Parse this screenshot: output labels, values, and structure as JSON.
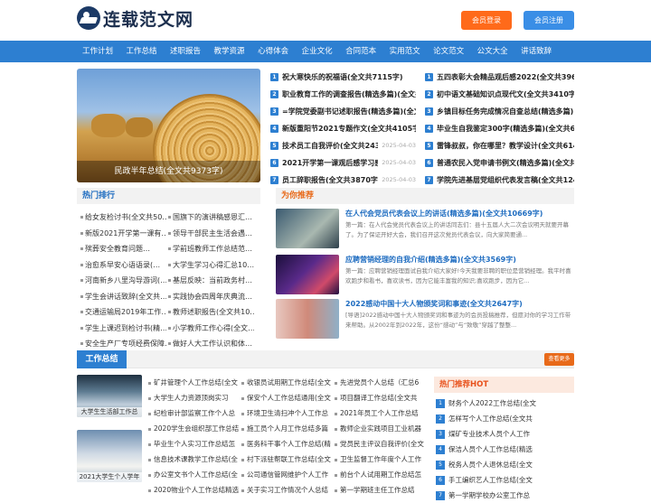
{
  "site": {
    "logo_text": "连载范文网",
    "login_label": "会员登录",
    "register_label": "会员注册"
  },
  "nav": [
    "工作计划",
    "工作总结",
    "述职报告",
    "教学资源",
    "心得体会",
    "企业文化",
    "合同范本",
    "实用范文",
    "论文范文",
    "公文大全",
    "讲话致辞"
  ],
  "banner": {
    "caption": "民政半年总结(全文共9373字)"
  },
  "top_left": [
    {
      "n": "1",
      "t": "祝大寒快乐的祝福语(全文共7115字)",
      "d": ""
    },
    {
      "n": "2",
      "t": "职业教育工作的调查报告(精选多篇)(全文共",
      "d": ""
    },
    {
      "n": "3",
      "t": "=学院党委副书记述职报告(精选多篇)(全文共",
      "d": ""
    },
    {
      "n": "4",
      "t": "新版重阳节2021专题作文(全文共4105字)",
      "d": ""
    },
    {
      "n": "5",
      "t": "技术员工自我评价(全文共2438字)",
      "d": "2025-04-03"
    },
    {
      "n": "6",
      "t": "2021开学第一课观后感学习感悟多篇(全文共",
      "d": "2025-04-03"
    },
    {
      "n": "7",
      "t": "员工辞职报告(全文共3870字)",
      "d": "2025-04-03"
    }
  ],
  "top_right": [
    {
      "n": "1",
      "t": "五四表彰大会精品观后感2022(全文共3960"
    },
    {
      "n": "2",
      "t": "初中语文基础知识点现代文(全文共3410字)"
    },
    {
      "n": "3",
      "t": "乡镇目标任务完成情况自查总结(精选多篇)"
    },
    {
      "n": "4",
      "t": "毕业生自我鉴定300字(精选多篇)(全文共6571"
    },
    {
      "n": "5",
      "t": "雷锋叔叔，你在哪里？教学设计(全文共614"
    },
    {
      "n": "6",
      "t": "普通农民入党申请书例文(精选多篇)(全文共"
    },
    {
      "n": "7",
      "t": "学院先进基层党组织代表发言稿(全文共1240"
    }
  ],
  "hot_rank": {
    "title": "热门排行",
    "left": [
      "给女友检讨书(全文共50…",
      "新版2021开学第一课有…",
      "殡葬安全教育问题…",
      "治愈系早安心语语录(…",
      "河南新乡八里沟导游词(…",
      "学生会讲话致辞(全文共…",
      "交通运输局2019年工作…",
      "学生上课迟到检讨书(精…",
      "安全生产厂专项经费保障…"
    ],
    "right": [
      "国旗下的演讲稿感恩汇…",
      "领导干部民主生活会遇…",
      "学前班教师工作总结范…",
      "大学生学习心得汇总10…",
      "基层反映：当前政务村…",
      "实践协会四周年庆典流…",
      "教师述职报告(全文共10…",
      "小学教师工作心得(全文…",
      "做好人大工作认识和体…"
    ]
  },
  "recommend": {
    "title": "为你推荐",
    "items": [
      {
        "title": "在人代会党员代表会议上的讲话(精选多篇)(全文共10669字)",
        "desc": "第一篇：在人代会党员代表会议上的讲话同志们：县十五届人大二次会议明天就要开幕了。为了保证开好大会，我们召开这次党员代表会议，向大家简要通..."
      },
      {
        "title": "应聘营销经理的自我介绍(精选多篇)(全文共3569字)",
        "desc": "第一篇：应聘营销经理面试自我介绍大家好!今天我要非聘的职位是营销经理。我平时喜欢跑步和看书，喜欢读书，因为它能丰富我的知识;喜欢跑步，因为它..."
      },
      {
        "title": "2022感动中国十大人物颁奖词和事迹(全文共2647字)",
        "desc": "[导语]2022感动中国十大人物颁奖词和事迹为的会员投稿推荐，但愿对你的学习工作带来帮助。从2002年到2022年，这份“感动”与“致敬”穿越了整整..."
      }
    ]
  },
  "work_summary": {
    "title": "工作总结",
    "more_label": "查看更多",
    "thumbs": [
      "大学生生活部工作总",
      "2021大学生个人学年"
    ],
    "col1": [
      "矿井管理个人工作总结(全文",
      "大学生人力资源顶岗实习",
      "纪检审计部监察工作个人总",
      "2020学生会组织部工作总结",
      "毕业生个人实习工作总结怎",
      "信息技术课教学工作总结(全",
      "办公室文书个人工作总结(全",
      "2020物业个人工作总结精选"
    ],
    "col2": [
      "收银员试用期工作总结(全文",
      "保安个人工作总结通用(全文",
      "环境卫生清扫冲个人工作总",
      "施工员个人月工作总结多篇",
      "医务科干事个人工作总结(精",
      "村下派驻帮联工作总结(全文",
      "公司通信管网维护个人工作",
      "关于实习工作情况个人总结"
    ],
    "col3": [
      "先进党员个人总结（汇总6",
      "项目翻译工作总结(全文共",
      "2021年员工个人工作总结",
      "教师企业实践项目工业机器",
      "党员民主评议自我评价(全文",
      "卫生监督工作年度个人工作",
      "前台个人试用期工作总结怎",
      "第一学期班主任工作总结"
    ]
  },
  "hot_recommend": {
    "title": "热门推荐HOT",
    "items": [
      {
        "n": "1",
        "t": "财务个人2022工作总结(全文"
      },
      {
        "n": "2",
        "t": "怎样写个人工作总结(全文共"
      },
      {
        "n": "3",
        "t": "煤矿专业技术人员个人工作"
      },
      {
        "n": "4",
        "t": "保洁人员个人工作总结(精选"
      },
      {
        "n": "5",
        "t": "税务人员个人退休总结(全文"
      },
      {
        "n": "6",
        "t": "手工编织艺人工作总结(全文"
      },
      {
        "n": "7",
        "t": "第一学期学校办公室工作总"
      }
    ]
  }
}
